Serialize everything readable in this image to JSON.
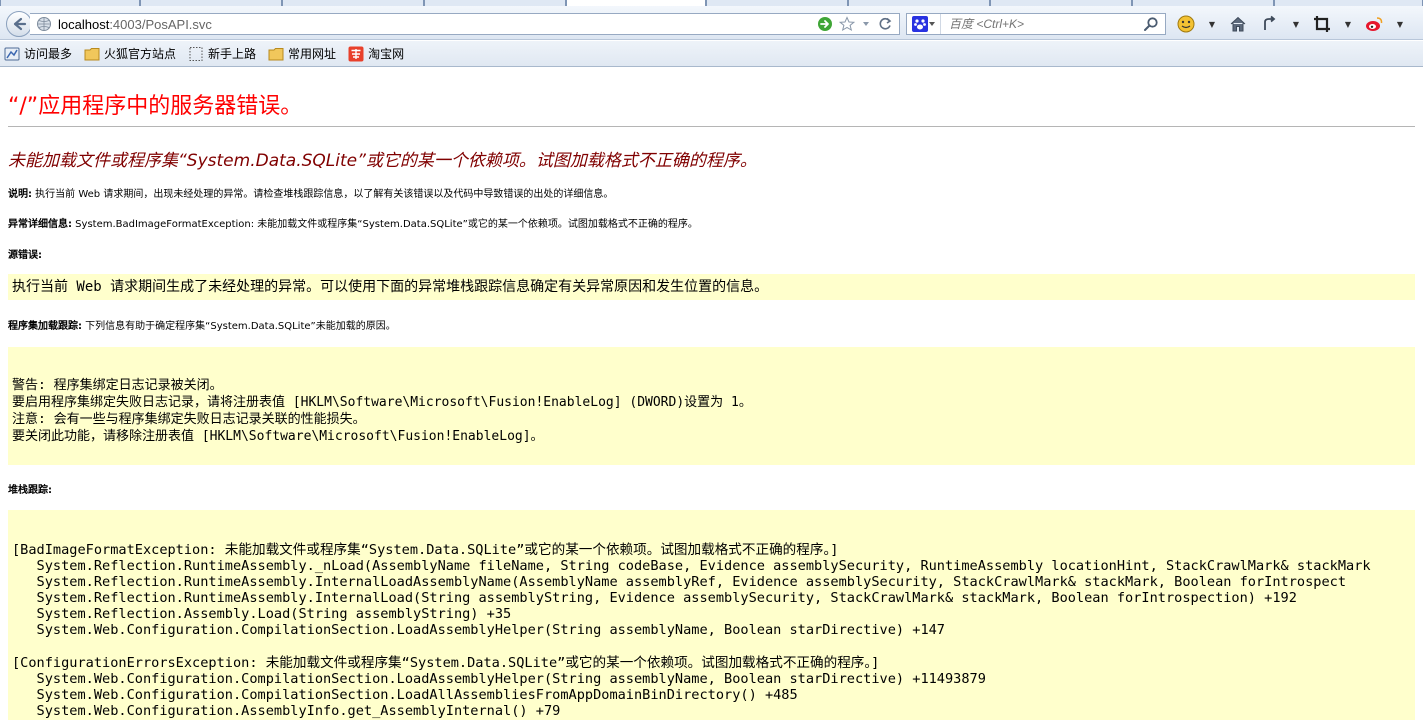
{
  "browser": {
    "url_host": "localhost",
    "url_path": ":4003/PosAPI.svc",
    "search_placeholder": "百度 <Ctrl+K>",
    "bookmarks": [
      {
        "label": "访问最多",
        "icon": "most-visited-icon"
      },
      {
        "label": "火狐官方站点",
        "icon": "folder-icon"
      },
      {
        "label": "新手上路",
        "icon": "dotted-page-icon"
      },
      {
        "label": "常用网址",
        "icon": "folder-icon"
      },
      {
        "label": "淘宝网",
        "icon": "taobao-icon"
      }
    ]
  },
  "page": {
    "title": "“/”应用程序中的服务器错误。",
    "subtitle": "未能加载文件或程序集“System.Data.SQLite”或它的某一个依赖项。试图加载格式不正确的程序。",
    "description_label": "说明:",
    "description_text": " 执行当前 Web 请求期间，出现未经处理的异常。请检查堆栈跟踪信息，以了解有关该错误以及代码中导致错误的出处的详细信息。",
    "exception_label": "异常详细信息:",
    "exception_text": " System.BadImageFormatException: 未能加载文件或程序集“System.Data.SQLite”或它的某一个依赖项。试图加载格式不正确的程序。",
    "source_error_label": "源错误:",
    "source_error_text": "执行当前 Web 请求期间生成了未经处理的异常。可以使用下面的异常堆栈跟踪信息确定有关异常原因和发生位置的信息。",
    "assembly_trace_label": "程序集加载跟踪:",
    "assembly_trace_text": " 下列信息有助于确定程序集“System.Data.SQLite”未能加载的原因。",
    "assembly_trace_box": "警告: 程序集绑定日志记录被关闭。\n要启用程序集绑定失败日志记录，请将注册表值 [HKLM\\Software\\Microsoft\\Fusion!EnableLog] (DWORD)设置为 1。\n注意: 会有一些与程序集绑定失败日志记录关联的性能损失。\n要关闭此功能，请移除注册表值 [HKLM\\Software\\Microsoft\\Fusion!EnableLog]。",
    "stack_trace_label": "堆栈跟踪:",
    "stack_trace_box": "[BadImageFormatException: 未能加载文件或程序集“System.Data.SQLite”或它的某一个依赖项。试图加载格式不正确的程序。]\n   System.Reflection.RuntimeAssembly._nLoad(AssemblyName fileName, String codeBase, Evidence assemblySecurity, RuntimeAssembly locationHint, StackCrawlMark& stackMark\n   System.Reflection.RuntimeAssembly.InternalLoadAssemblyName(AssemblyName assemblyRef, Evidence assemblySecurity, StackCrawlMark& stackMark, Boolean forIntrospect\n   System.Reflection.RuntimeAssembly.InternalLoad(String assemblyString, Evidence assemblySecurity, StackCrawlMark& stackMark, Boolean forIntrospection) +192\n   System.Reflection.Assembly.Load(String assemblyString) +35\n   System.Web.Configuration.CompilationSection.LoadAssemblyHelper(String assemblyName, Boolean starDirective) +147\n\n[ConfigurationErrorsException: 未能加载文件或程序集“System.Data.SQLite”或它的某一个依赖项。试图加载格式不正确的程序。]\n   System.Web.Configuration.CompilationSection.LoadAssemblyHelper(String assemblyName, Boolean starDirective) +11493879\n   System.Web.Configuration.CompilationSection.LoadAllAssembliesFromAppDomainBinDirectory() +485\n   System.Web.Configuration.AssemblyInfo.get_AssemblyInternal() +79"
  },
  "colors": {
    "title_red": "#ff0000",
    "subtitle_maroon": "#800000",
    "code_bg": "#ffffcc"
  }
}
